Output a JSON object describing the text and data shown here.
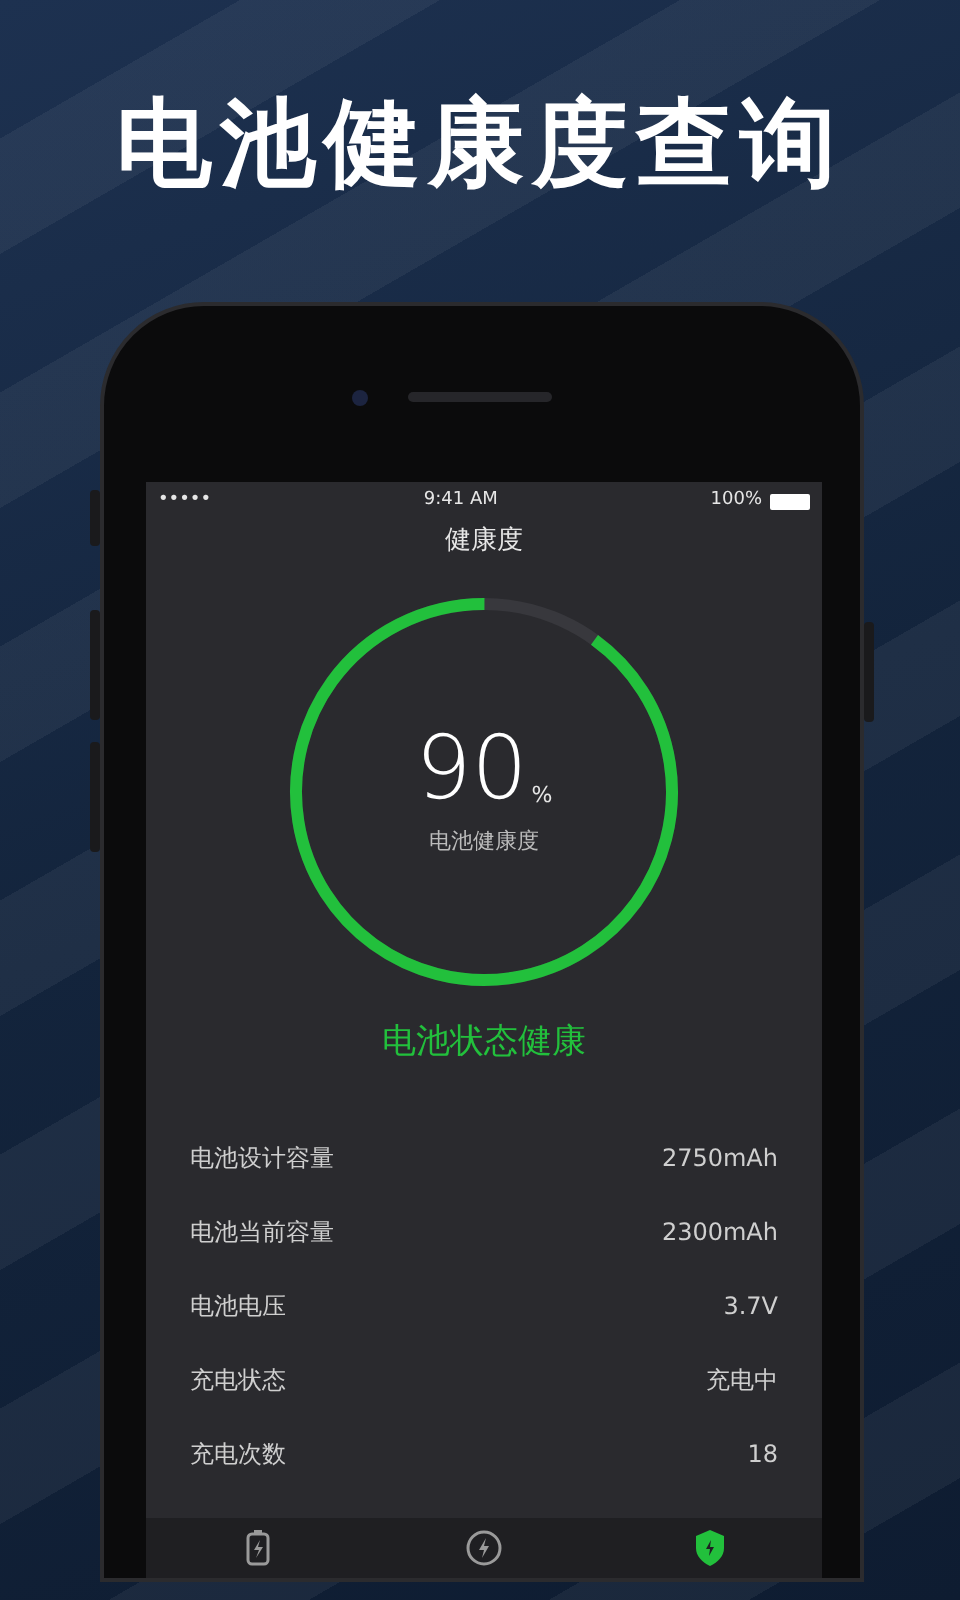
{
  "headline": "电池健康度查询",
  "status_bar": {
    "signal": "•••••",
    "time": "9:41 AM",
    "battery": "100%"
  },
  "nav_title": "健康度",
  "gauge": {
    "value": "90",
    "unit": "%",
    "caption": "电池健康度",
    "level": 0.9
  },
  "health_status": "电池状态健康",
  "details": [
    {
      "label": "电池设计容量",
      "value": "2750mAh"
    },
    {
      "label": "电池当前容量",
      "value": "2300mAh"
    },
    {
      "label": "电池电压",
      "value": "3.7V"
    },
    {
      "label": "充电状态",
      "value": "充电中"
    },
    {
      "label": "充电次数",
      "value": "18"
    }
  ],
  "tab_bar": [
    {
      "kind": "battery",
      "selected": false
    },
    {
      "kind": "charge",
      "selected": false
    },
    {
      "kind": "shield",
      "selected": true
    }
  ]
}
